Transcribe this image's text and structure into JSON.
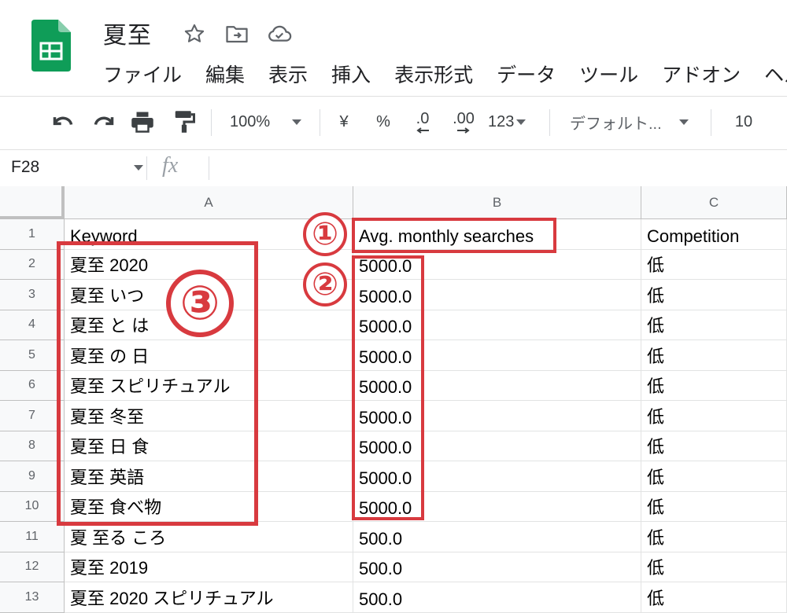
{
  "doc": {
    "title": "夏至"
  },
  "menu": [
    "ファイル",
    "編集",
    "表示",
    "挿入",
    "表示形式",
    "データ",
    "ツール",
    "アドオン",
    "ヘル"
  ],
  "toolbar": {
    "zoom": "100%",
    "currency": "¥",
    "percent": "%",
    "decrease_decimal": ".0",
    "increase_decimal": ".00",
    "more_formats": "123",
    "font": "デフォルト...",
    "font_size": "10"
  },
  "formula_bar": {
    "cell_ref": "F28",
    "fx": "fx"
  },
  "columns": [
    "A",
    "B",
    "C"
  ],
  "rows": [
    {
      "num": "1",
      "a": "Keyword",
      "b": "Avg. monthly searches",
      "c": "Competition"
    },
    {
      "num": "2",
      "a": "夏至 2020",
      "b": "5000.0",
      "c": "低"
    },
    {
      "num": "3",
      "a": "夏至 いつ",
      "b": "5000.0",
      "c": "低"
    },
    {
      "num": "4",
      "a": "夏至 と は",
      "b": "5000.0",
      "c": "低"
    },
    {
      "num": "5",
      "a": "夏至 の 日",
      "b": "5000.0",
      "c": "低"
    },
    {
      "num": "6",
      "a": "夏至 スピリチュアル",
      "b": "5000.0",
      "c": "低"
    },
    {
      "num": "7",
      "a": "夏至 冬至",
      "b": "5000.0",
      "c": "低"
    },
    {
      "num": "8",
      "a": "夏至 日 食",
      "b": "5000.0",
      "c": "低"
    },
    {
      "num": "9",
      "a": "夏至 英語",
      "b": "5000.0",
      "c": "低"
    },
    {
      "num": "10",
      "a": "夏至 食べ物",
      "b": "5000.0",
      "c": "低"
    },
    {
      "num": "11",
      "a": "夏 至る ころ",
      "b": "500.0",
      "c": "低"
    },
    {
      "num": "12",
      "a": "夏至 2019",
      "b": "500.0",
      "c": "低"
    },
    {
      "num": "13",
      "a": "夏至 2020 スピリチュアル",
      "b": "500.0",
      "c": "低"
    }
  ],
  "annotations": [
    "①",
    "②",
    "③"
  ],
  "colors": {
    "annotation": "#d83a3f",
    "sheets_green": "#0f9d58"
  }
}
